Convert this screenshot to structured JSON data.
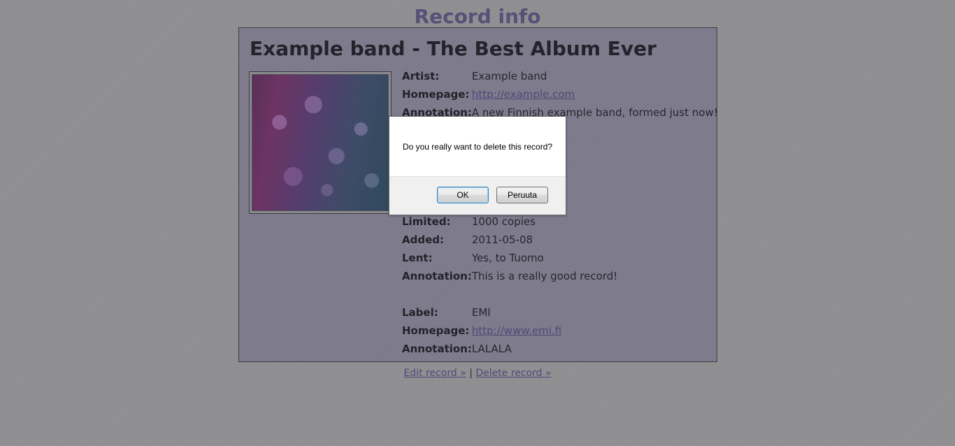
{
  "page": {
    "title": "Record info"
  },
  "record": {
    "heading": "Example band - The Best Album Ever",
    "cover_alt": "Album cover",
    "artist_section": [
      {
        "label": "Artist:",
        "value": "Example band"
      },
      {
        "label": "Homepage:",
        "value": "http://example.com",
        "link": true
      },
      {
        "label": "Annotation:",
        "value": "A new Finnish example band, formed just now!"
      }
    ],
    "release_section": [
      {
        "label": "Limited:",
        "value": "1000 copies"
      },
      {
        "label": "Added:",
        "value": "2011-05-08"
      },
      {
        "label": "Lent:",
        "value": "Yes, to Tuomo"
      },
      {
        "label": "Annotation:",
        "value": "This is a really good record!"
      }
    ],
    "label_section": [
      {
        "label": "Label:",
        "value": "EMI"
      },
      {
        "label": "Homepage:",
        "value": "http://www.emi.fi",
        "link": true
      },
      {
        "label": "Annotation:",
        "value": "LALALA"
      }
    ]
  },
  "footer": {
    "edit_label": "Edit record »",
    "separator": "|",
    "delete_label": "Delete record »"
  },
  "dialog": {
    "message": "Do you really want to delete this record?",
    "ok_label": "OK",
    "cancel_label": "Peruuta"
  }
}
